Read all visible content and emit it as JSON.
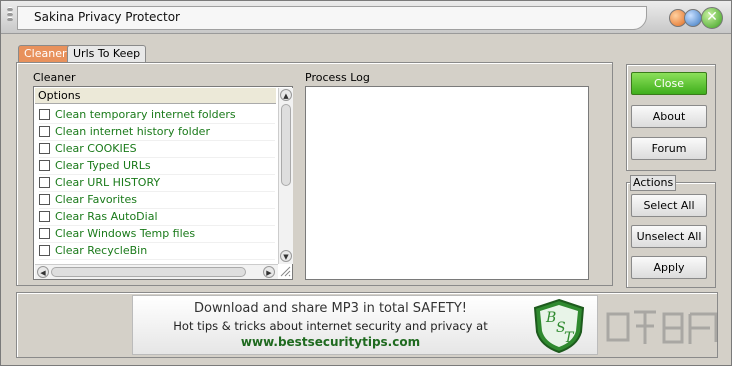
{
  "window": {
    "title": "Sakina Privacy Protector"
  },
  "tabs": [
    {
      "label": "Cleaner",
      "active": true
    },
    {
      "label": "Urls To Keep",
      "active": false
    }
  ],
  "cleaner": {
    "group_label": "Cleaner",
    "list_header": "Options",
    "options": [
      {
        "label": "Clean temporary internet folders",
        "checked": false
      },
      {
        "label": "Clean internet history folder",
        "checked": false
      },
      {
        "label": "Clear COOKIES",
        "checked": false
      },
      {
        "label": "Clear Typed URLs",
        "checked": false
      },
      {
        "label": "Clear URL HISTORY",
        "checked": false
      },
      {
        "label": "Clear Favorites",
        "checked": false
      },
      {
        "label": "Clear Ras AutoDial",
        "checked": false
      },
      {
        "label": "Clear Windows Temp files",
        "checked": false
      },
      {
        "label": "Clear RecycleBin",
        "checked": false
      }
    ]
  },
  "process_log": {
    "label": "Process Log",
    "content": ""
  },
  "buttons": {
    "close": "Close",
    "about": "About",
    "forum": "Forum"
  },
  "actions": {
    "label": "Actions",
    "select_all": "Select All",
    "unselect_all": "Unselect All",
    "apply": "Apply"
  },
  "banner": {
    "line1": "Download and share MP3  in total SAFETY!",
    "line2": "Hot tips & tricks about internet security and privacy at",
    "line3": "www.bestsecuritytips.com",
    "logo_text": "BST"
  },
  "colors": {
    "accent_green": "#3fae1c",
    "tab_active": "#e8915c",
    "option_text": "#1a7a1a"
  }
}
